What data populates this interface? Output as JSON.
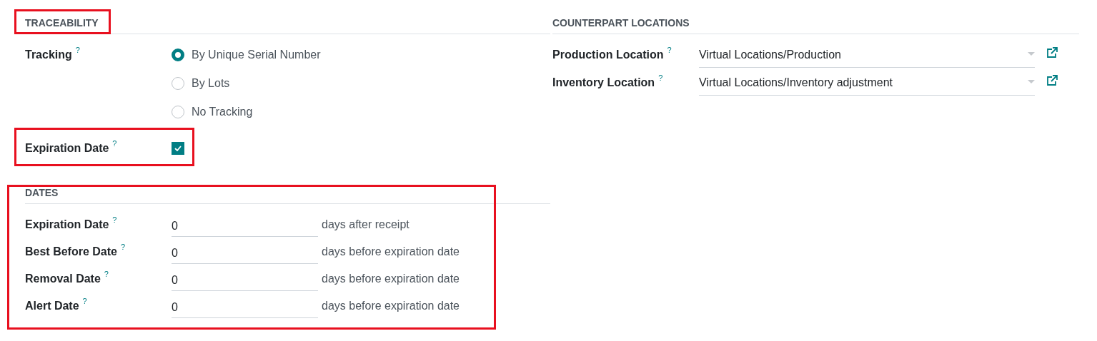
{
  "traceability": {
    "title": "TRACEABILITY",
    "tracking": {
      "label": "Tracking",
      "help": "?",
      "options": [
        {
          "label": "By Unique Serial Number",
          "selected": true
        },
        {
          "label": "By Lots",
          "selected": false
        },
        {
          "label": "No Tracking",
          "selected": false
        }
      ]
    },
    "expiration": {
      "label": "Expiration Date",
      "help": "?",
      "checked": true
    }
  },
  "dates": {
    "title": "DATES",
    "rows": [
      {
        "label": "Expiration Date",
        "help": "?",
        "value": "0",
        "unit": "days after receipt"
      },
      {
        "label": "Best Before Date",
        "help": "?",
        "value": "0",
        "unit": "days before expiration date"
      },
      {
        "label": "Removal Date",
        "help": "?",
        "value": "0",
        "unit": "days before expiration date"
      },
      {
        "label": "Alert Date",
        "help": "?",
        "value": "0",
        "unit": "days before expiration date"
      }
    ]
  },
  "counterpart_locations": {
    "title": "COUNTERPART LOCATIONS",
    "rows": [
      {
        "label": "Production Location",
        "help": "?",
        "value": "Virtual Locations/Production"
      },
      {
        "label": "Inventory Location",
        "help": "?",
        "value": "Virtual Locations/Inventory adjustment"
      }
    ]
  }
}
